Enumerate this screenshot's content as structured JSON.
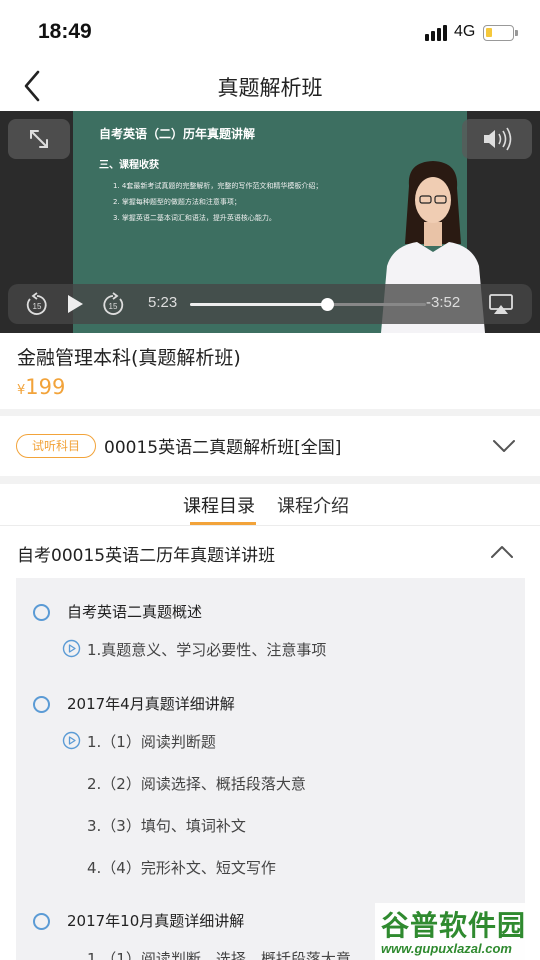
{
  "status_bar": {
    "time": "18:49",
    "network": "4G"
  },
  "nav": {
    "title": "真题解析班"
  },
  "video": {
    "slide_title": "自考英语（二）历年真题讲解",
    "slide_heading": "三、课程收获",
    "slide_items": [
      "1. 4套最新考试真题的完整解析，完整的写作范文和精华模板介绍；",
      "2. 掌握每种题型的做题方法和注意事项；",
      "3. 掌握英语二基本词汇和语法，提升英语核心能力。"
    ],
    "current_time": "5:23",
    "remaining_time": "-3:52",
    "progress": 0.58,
    "skip_seconds": "15"
  },
  "course": {
    "name": "金融管理本科(真题解析班)",
    "currency": "¥",
    "price": "199"
  },
  "trial": {
    "badge": "试听科目",
    "text": "00015英语二真题解析班[全国]"
  },
  "tabs": [
    {
      "label": "课程目录",
      "active": true
    },
    {
      "label": "课程介绍",
      "active": false
    }
  ],
  "section": {
    "title": "自考00015英语二历年真题详讲班"
  },
  "outline": {
    "ch1": {
      "title": "自考英语二真题概述",
      "lessons": [
        "1.真题意义、学习必要性、注意事项"
      ]
    },
    "ch2": {
      "title": "2017年4月真题详细讲解",
      "lessons": [
        "1.（1）阅读判断题",
        "2.（2）阅读选择、概括段落大意",
        "3.（3）填句、填词补文",
        "4.（4）完形补文、短文写作"
      ]
    },
    "ch3": {
      "title": "2017年10月真题详细讲解",
      "lessons": [
        "1.（1）阅读判断、选择、概括段落大意"
      ]
    }
  },
  "watermark": {
    "logo": "谷普软件园",
    "url": "www.gupuxlazal.com"
  },
  "colors": {
    "accent": "#f2a33a",
    "chapter_circle": "#5b9bd5",
    "slide_bg": "#3d6f61"
  }
}
